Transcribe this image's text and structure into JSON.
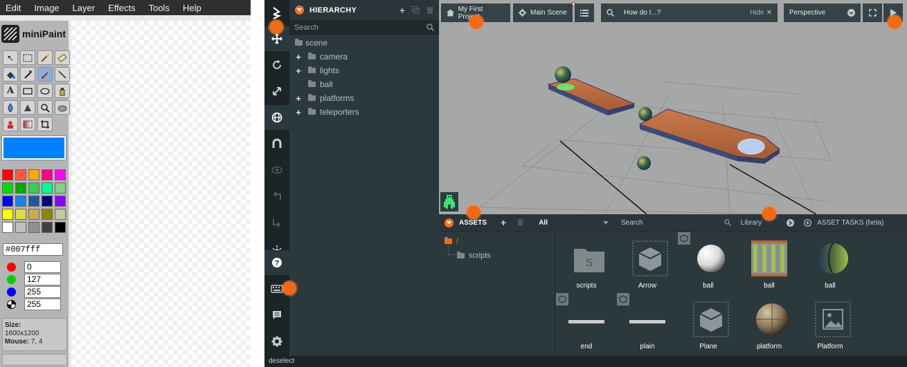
{
  "minipaint": {
    "menu": [
      "Edit",
      "Image",
      "Layer",
      "Effects",
      "Tools",
      "Help"
    ],
    "logo_text": "miniPaint",
    "current_color": "#007fff",
    "hex_value": "#007fff",
    "channels": [
      {
        "color": "#ff0000",
        "value": "0"
      },
      {
        "color": "#00d000",
        "value": "127"
      },
      {
        "color": "#0000ff",
        "value": "255"
      },
      {
        "color": "#000000",
        "value": "255"
      }
    ],
    "palette": [
      "#ff0000",
      "#ff5a3a",
      "#ffaa00",
      "#ff0090",
      "#ff00ff",
      "#00dd00",
      "#00aa00",
      "#3ccc55",
      "#00ff99",
      "#88cc88",
      "#0000ff",
      "#1a7fff",
      "#2255aa",
      "#000080",
      "#8800ff",
      "#ffff00",
      "#dddd44",
      "#ccaa55",
      "#888800",
      "#c8c8a0",
      "#ffffff",
      "#c0c0c0",
      "#909090",
      "#404040",
      "#000000"
    ],
    "size_label": "Size:",
    "size_value": "1600x1200",
    "mouse_label": "Mouse:",
    "mouse_value": "7, 4"
  },
  "editor": {
    "hierarchy": {
      "title": "HIERARCHY",
      "search_placeholder": "Search",
      "items": [
        {
          "label": "scene"
        },
        {
          "label": "camera"
        },
        {
          "label": "lights"
        },
        {
          "label": "ball"
        },
        {
          "label": "platforms"
        },
        {
          "label": "teleporters"
        }
      ]
    },
    "viewport": {
      "project_label": "My First Project",
      "scene_label": "Main Scene",
      "help_placeholder": "How do I...?",
      "help_hide": "Hide",
      "camera_label": "Perspective"
    },
    "assets": {
      "title": "ASSETS",
      "filter_value": "All",
      "search_placeholder": "Search",
      "library_label": "Library",
      "tasks_label": "ASSET TASKS (beta)",
      "root_folder": "/",
      "subfolder": "scripts",
      "items": [
        {
          "label": "scripts"
        },
        {
          "label": "Arrow"
        },
        {
          "label": "ball"
        },
        {
          "label": "ball"
        },
        {
          "label": "ball"
        },
        {
          "label": "end"
        },
        {
          "label": "plain"
        },
        {
          "label": "Plane"
        },
        {
          "label": "platform"
        },
        {
          "label": "Platform"
        }
      ]
    },
    "status_text": "deselect",
    "accent": "#fb6e28"
  }
}
